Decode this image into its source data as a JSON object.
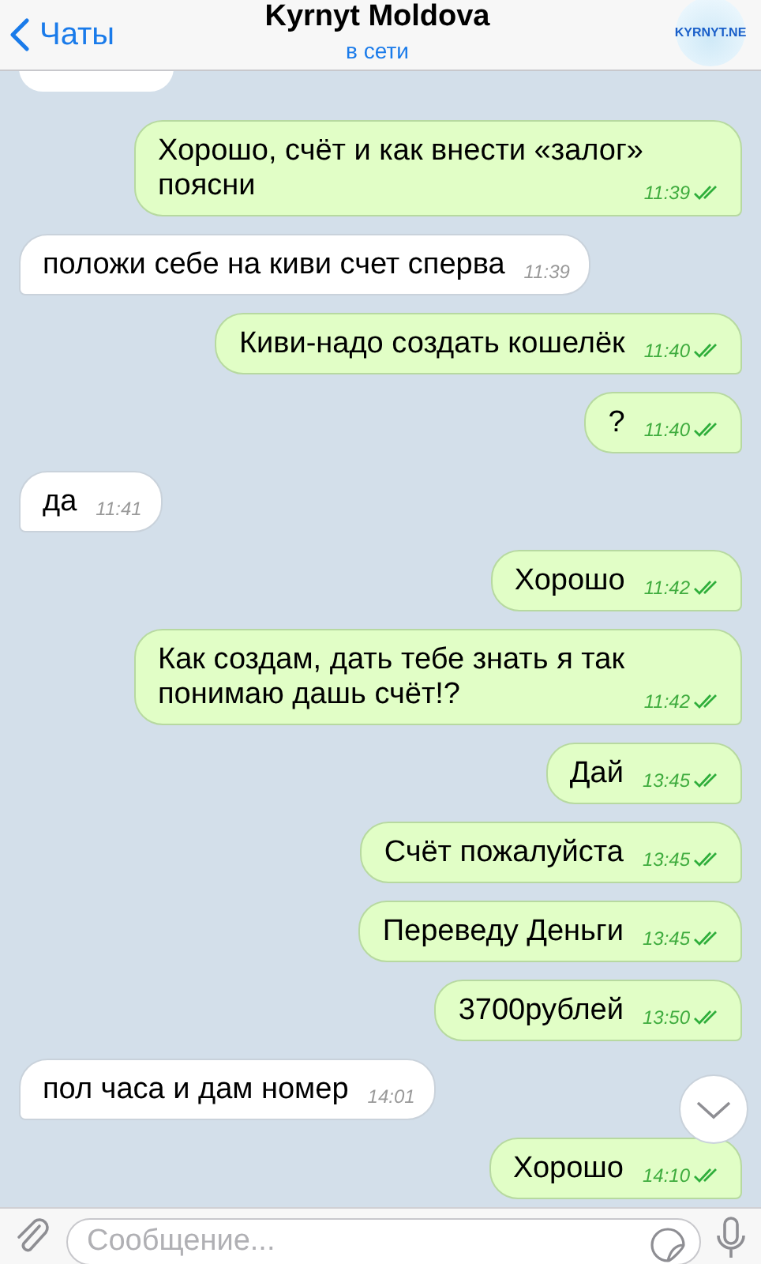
{
  "header": {
    "back_label": "Чаты",
    "title": "Kyrnyt Moldova",
    "status": "в сети",
    "avatar_text": "KYRNYT.NE"
  },
  "messages": [
    {
      "kind": "cut"
    },
    {
      "kind": "out",
      "text": "Хорошо, счёт и как внести «залог» поясни",
      "time": "11:39",
      "read": true
    },
    {
      "kind": "in",
      "text": "положи себе на киви счет сперва",
      "time": "11:39"
    },
    {
      "kind": "out",
      "text": "Киви-надо создать кошелёк",
      "time": "11:40",
      "read": true
    },
    {
      "kind": "out",
      "text": "?",
      "time": "11:40",
      "read": true
    },
    {
      "kind": "in",
      "text": "да",
      "time": "11:41"
    },
    {
      "kind": "out",
      "text": "Хорошо",
      "time": "11:42",
      "read": true
    },
    {
      "kind": "out",
      "text": "Как создам, дать тебе знать я так понимаю дашь счёт!?",
      "time": "11:42",
      "read": true
    },
    {
      "kind": "out",
      "text": "Дай",
      "time": "13:45",
      "read": true
    },
    {
      "kind": "out",
      "text": "Счёт пожалуйста",
      "time": "13:45",
      "read": true
    },
    {
      "kind": "out",
      "text": "Переведу Деньги",
      "time": "13:45",
      "read": true
    },
    {
      "kind": "out",
      "text": "3700рублей",
      "time": "13:50",
      "read": true
    },
    {
      "kind": "in",
      "text": "пол часа и дам номер",
      "time": "14:01"
    },
    {
      "kind": "out",
      "text": "Хорошо",
      "time": "14:10",
      "read": true
    }
  ],
  "input": {
    "placeholder": "Сообщение..."
  }
}
